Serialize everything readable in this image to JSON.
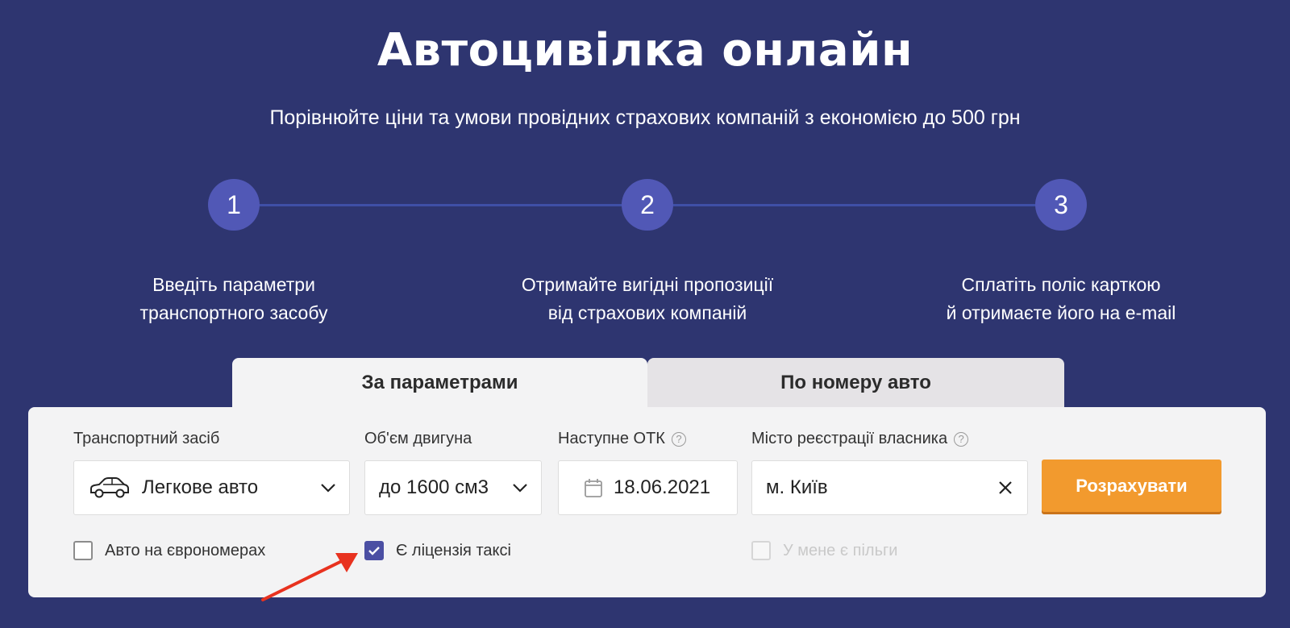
{
  "hero": {
    "title": "Автоцивілка онлайн",
    "subtitle": "Порівнюйте ціни та умови провідних страхових компаній з економією до 500 грн"
  },
  "steps": [
    {
      "number": "1",
      "line1": "Введіть параметри",
      "line2": "транспортного засобу"
    },
    {
      "number": "2",
      "line1": "Отримайте вигідні пропозиції",
      "line2": "від страхових компаній"
    },
    {
      "number": "3",
      "line1": "Сплатіть поліс карткою",
      "line2": "й отримаєте його на e-mail"
    }
  ],
  "tabs": {
    "by_params": "За параметрами",
    "by_number": "По номеру авто"
  },
  "form": {
    "vehicle": {
      "label": "Транспортний засіб",
      "value": "Легкове авто",
      "icon": "car-icon"
    },
    "engine": {
      "label": "Об'єм двигуна",
      "value": "до 1600 см3"
    },
    "inspection": {
      "label": "Наступне ОТК",
      "value": "18.06.2021",
      "icon": "calendar-icon",
      "help": "?"
    },
    "city": {
      "label": "Місто реєстрації власника",
      "value": "м. Київ",
      "help": "?"
    },
    "submit": "Розрахувати",
    "checkboxes": {
      "euro_plates": {
        "label": "Авто на єврономерах",
        "checked": false
      },
      "taxi_license": {
        "label": "Є ліцензія таксі",
        "checked": true
      },
      "benefits": {
        "label": "У мене є пільги",
        "checked": false,
        "disabled": true
      }
    }
  },
  "colors": {
    "background": "#2e3570",
    "step_circle": "#5158b6",
    "accent_button": "#f29a2e",
    "checkbox_checked": "#4b4fa3",
    "annotation_arrow": "#e8321f"
  }
}
